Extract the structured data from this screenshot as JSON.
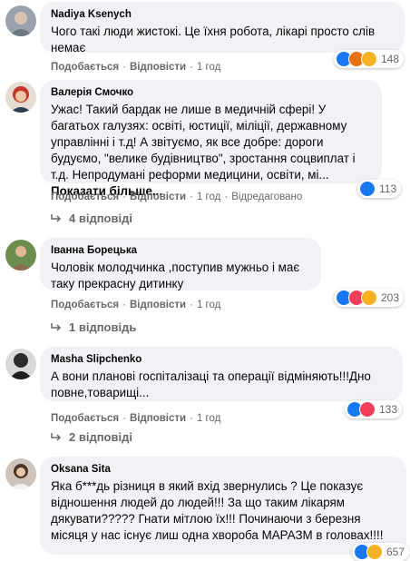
{
  "comments": [
    {
      "author": "Nadiya Ksenych",
      "text": "Чого такі люди жистокі. Це їхня робота, лікарі просто слів немає",
      "see_more": "",
      "actions": {
        "like": "Подобається",
        "reply": "Відповісти",
        "time": "1 год",
        "edited": ""
      },
      "reaction_count": "148",
      "reaction_icons": [
        "like-icon",
        "angry-icon",
        "sad-icon"
      ],
      "replies": ""
    },
    {
      "author": "Валерія Смочко",
      "text": "Ужас! Такий бардак не лише в медичній сфері! У багатьох галузях: освіті, юстиції, міліції, державному управлінні і т.д! А звітуємо, як все добре: дороги будуємо, \"велике будівництво\", зростання соцвиплат і т.д. Непродумані реформи медицини, освіти, мі... ",
      "see_more": "Показати більше...",
      "actions": {
        "like": "Подобається",
        "reply": "Відповісти",
        "time": "1 год",
        "edited": "Відредаговано"
      },
      "reaction_count": "113",
      "reaction_icons": [
        "like-icon"
      ],
      "replies": "4 відповіді"
    },
    {
      "author": "Іванна Борецька",
      "text": "Чоловік молодчинка ,поступив мужньо і має таку прекрасну дитинку",
      "see_more": "",
      "actions": {
        "like": "Подобається",
        "reply": "Відповісти",
        "time": "1 год",
        "edited": ""
      },
      "reaction_count": "203",
      "reaction_icons": [
        "like-icon",
        "love-icon",
        "sad-icon"
      ],
      "replies": "1 відповідь"
    },
    {
      "author": "Masha Slipchenko",
      "text": "А вони планові госпіталізаці та операції відміняють!!!Дно повне,товарищі...",
      "see_more": "",
      "actions": {
        "like": "Подобається",
        "reply": "Відповісти",
        "time": "1 год",
        "edited": ""
      },
      "reaction_count": "133",
      "reaction_icons": [
        "like-icon",
        "love-icon"
      ],
      "replies": "2 відповіді"
    },
    {
      "author": "Oksana Sita",
      "text": "Яка б***дь різниця в який вхід звернулись ? Це показує відношення людей до людей!!! За що таким лікарям дякувати????? Гнати мітлою їх!!! Починаючи з березня місяця у нас існує лиш одна хвороба МАРАЗМ в головах!!!!",
      "see_more": "",
      "actions": {
        "like": "",
        "reply": "",
        "time": "",
        "edited": ""
      },
      "reaction_count": "657",
      "reaction_icons": [
        "like-icon",
        "wow-icon"
      ],
      "replies": ""
    }
  ],
  "colors": {
    "bubble": "#f0f2f5",
    "meta_text": "#65676b",
    "like_blue": "#1877f2",
    "love_red": "#f33e58",
    "sad_yellow": "#f7b125",
    "angry_orange": "#e9710f"
  }
}
